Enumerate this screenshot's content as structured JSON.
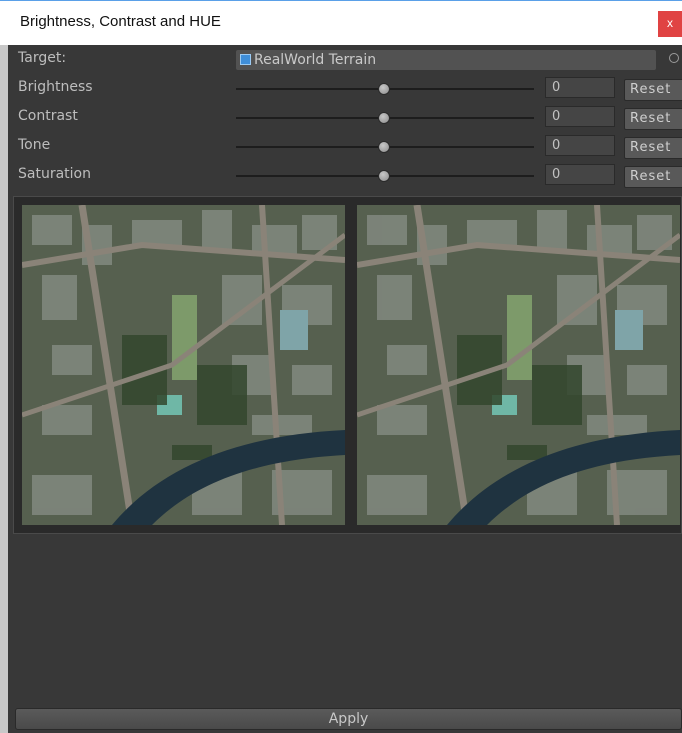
{
  "window": {
    "title": "Brightness, Contrast and HUE",
    "close_label": "x"
  },
  "target": {
    "label": "Target:",
    "value": "RealWorld Terrain"
  },
  "sliders": [
    {
      "label": "Brightness",
      "value": "0",
      "reset_label": "Reset",
      "position": 0.5
    },
    {
      "label": "Contrast",
      "value": "0",
      "reset_label": "Reset",
      "position": 0.5
    },
    {
      "label": "Tone",
      "value": "0",
      "reset_label": "Reset",
      "position": 0.5
    },
    {
      "label": "Saturation",
      "value": "0",
      "reset_label": "Reset",
      "position": 0.5
    }
  ],
  "preview": {
    "left_image": "original-aerial-city-map",
    "right_image": "processed-aerial-city-map"
  },
  "apply_label": "Apply",
  "colors": {
    "panel": "#383838",
    "close": "#e04343",
    "target_icon": "#3f8ed8"
  }
}
